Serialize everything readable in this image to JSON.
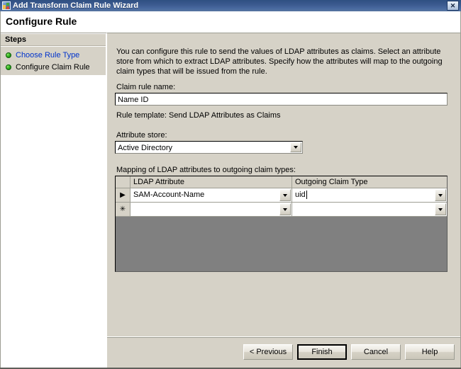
{
  "window": {
    "title": "Add Transform Claim Rule Wizard",
    "close_label": "✕",
    "app_icon": "wizard-app-icon"
  },
  "header": {
    "page_title": "Configure Rule"
  },
  "sidebar": {
    "header": "Steps",
    "items": [
      {
        "label": "Choose Rule Type",
        "state": "link"
      },
      {
        "label": "Configure Claim Rule",
        "state": "current"
      }
    ]
  },
  "main": {
    "intro": "You can configure this rule to send the values of LDAP attributes as claims. Select an attribute store from which to extract LDAP attributes. Specify how the attributes will map to the outgoing claim types that will be issued from the rule.",
    "claim_rule_name_label": "Claim rule name:",
    "claim_rule_name_value": "Name ID",
    "rule_template_label": "Rule template: Send LDAP Attributes as Claims",
    "attribute_store_label": "Attribute store:",
    "attribute_store_value": "Active Directory",
    "mapping_label": "Mapping of LDAP attributes to outgoing claim types:"
  },
  "grid": {
    "columns": [
      "",
      "LDAP Attribute",
      "Outgoing Claim Type"
    ],
    "rows": [
      {
        "selector": "▶",
        "ldap_attribute": "SAM-Account-Name",
        "outgoing_claim_type": "uid"
      },
      {
        "selector": "✳",
        "ldap_attribute": "",
        "outgoing_claim_type": ""
      }
    ]
  },
  "footer": {
    "buttons": [
      {
        "label": "< Previous",
        "default": false
      },
      {
        "label": "Finish",
        "default": true
      },
      {
        "label": "Cancel",
        "default": false
      },
      {
        "label": "Help",
        "default": false
      }
    ]
  }
}
